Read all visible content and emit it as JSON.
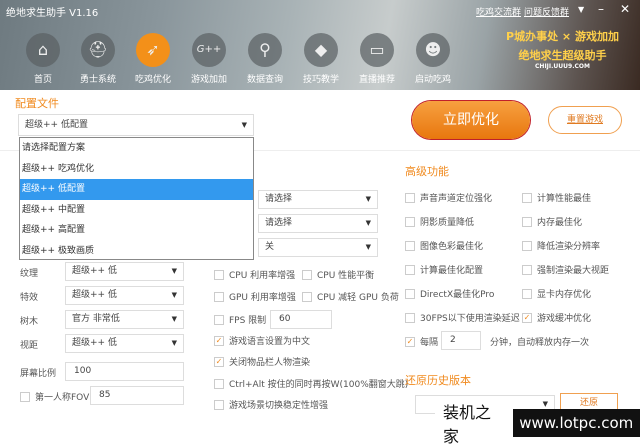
{
  "window": {
    "title": "绝地求生助手 V1.16",
    "links": [
      "吃鸡交流群",
      "问题反馈群"
    ],
    "menu_icon": "▼",
    "min_icon": "–",
    "close_icon": "✕"
  },
  "nav": [
    {
      "label": "首页",
      "icon": "⌂"
    },
    {
      "label": "勇士系统",
      "icon": "⛑"
    },
    {
      "label": "吃鸡优化",
      "icon": "➶",
      "active": true
    },
    {
      "label": "游戏加加",
      "icon": "G++"
    },
    {
      "label": "数据查询",
      "icon": "⚲"
    },
    {
      "label": "技巧教学",
      "icon": "◆"
    },
    {
      "label": "直播推荐",
      "icon": "▭"
    },
    {
      "label": "启动吃鸡",
      "icon": "☻"
    }
  ],
  "brand": {
    "line1": "P城办事处 × 游戏加加",
    "line2": "绝地求生超级助手",
    "line3": "CHIJI.UUU9.COM"
  },
  "config": {
    "title": "配置文件",
    "selected": "超级++ 低配置",
    "options": [
      "请选择配置方案",
      "超级++ 吃鸡优化",
      "超级++ 低配置",
      "超级++ 中配置",
      "超级++ 高配置",
      "超级++ 极致画质"
    ]
  },
  "actions": {
    "optimize": "立即优化",
    "reset": "重置游戏"
  },
  "middle_selects": [
    "请选择",
    "请选择",
    "关"
  ],
  "quality": [
    {
      "label": "纹理",
      "value": "超级++ 低"
    },
    {
      "label": "特效",
      "value": "超级++ 低"
    },
    {
      "label": "树木",
      "value": "官方 非常低"
    },
    {
      "label": "视距",
      "value": "超级++ 低"
    }
  ],
  "screen_ratio": {
    "label": "屏幕比例",
    "value": "100"
  },
  "fov": {
    "label": "第一人称FOV",
    "value": "85",
    "checked": false
  },
  "options": {
    "cpu_boost": "CPU 利用率增强",
    "cpu_balance": "CPU 性能平衡",
    "gpu_boost": "GPU 利用率增强",
    "cpu_reduce_gpu": "CPU 减轻 GPU 负荷",
    "fps_limit": "FPS 限制",
    "fps_value": "60",
    "lang_cn": "游戏语言设置为中文",
    "close_render": "关闭物品栏人物渲染",
    "ctrl_alt": "Ctrl+Alt 按住的同时再按W(100%翻窗大跳)",
    "scene_stable": "游戏场景切换稳定性增强"
  },
  "advanced": {
    "title": "高级功能",
    "items": [
      {
        "label": "声音声道定位强化",
        "checked": false
      },
      {
        "label": "计算性能最佳",
        "checked": false
      },
      {
        "label": "阴影质量降低",
        "checked": false
      },
      {
        "label": "内存最佳化",
        "checked": false
      },
      {
        "label": "图像色彩最佳化",
        "checked": false
      },
      {
        "label": "降低渲染分辨率",
        "checked": false
      },
      {
        "label": "计算最佳化配置",
        "checked": false
      },
      {
        "label": "强制渲染最大视距",
        "checked": false
      },
      {
        "label": "DirectX最佳化Pro",
        "checked": false
      },
      {
        "label": "显卡内存优化",
        "checked": false
      },
      {
        "label": "30FPS以下使用渲染延迟",
        "checked": false
      },
      {
        "label": "游戏缓冲优化",
        "checked": true
      }
    ],
    "interval_label": "每隔",
    "interval_value": "2",
    "interval_suffix": "分钟，自动释放内存一次"
  },
  "restore": {
    "title": "还原历史版本",
    "button": "还原",
    "selected": ""
  },
  "watermark": {
    "cn": "装机之家",
    "url": "www.lotpc.com"
  },
  "colors": {
    "accent": "#f08a1e",
    "highlight": "#3399ee"
  }
}
